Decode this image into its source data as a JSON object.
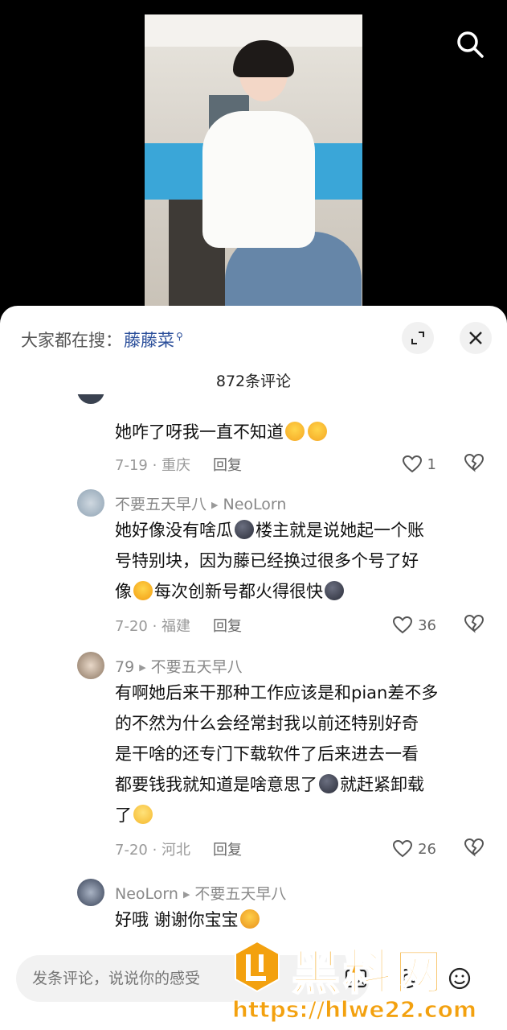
{
  "search_bar": {
    "prefix": "大家都在搜：",
    "keyword": "藤藤菜"
  },
  "comment_count": "872条评论",
  "comments": [
    {
      "user": "",
      "reply_to": "",
      "text": "她咋了呀我一直不知道",
      "emojis": [
        "cry-emoji",
        "cry-emoji"
      ],
      "date_loc": "7-19 · 重庆",
      "reply": "回复",
      "likes": "1"
    },
    {
      "user": "不要五天早八",
      "reply_to": "NeoLorn",
      "text_lines": [
        "她好像没有啥瓜",
        "楼主就是说她起一个账",
        "号特别块，因为藤已经换过很多个号了好",
        "像",
        "每次创新号都火得很快"
      ],
      "date_loc": "7-20 · 福建",
      "reply": "回复",
      "likes": "36"
    },
    {
      "user": "79",
      "reply_to": "不要五天早八",
      "text_lines": [
        "有啊她后来干那种工作应该是和pian差不多",
        "的不然为什么会经常封我以前还特别好奇",
        "是干啥的还专门下载软件了后来进去一看",
        "都要钱我就知道是啥意思了",
        "就赶紧卸载",
        "了"
      ],
      "date_loc": "7-20 · 河北",
      "reply": "回复",
      "likes": "26"
    },
    {
      "user": "NeoLorn",
      "reply_to": "不要五天早八",
      "text": "好哦  谢谢你宝宝"
    }
  ],
  "input": {
    "placeholder": "发条评论，说说你的感受"
  },
  "watermark": {
    "name": "黑料网",
    "url": "https://hlwe22.com"
  },
  "colors": {
    "keyword": "#2a4e9a",
    "watermark": "#f3a10f"
  }
}
